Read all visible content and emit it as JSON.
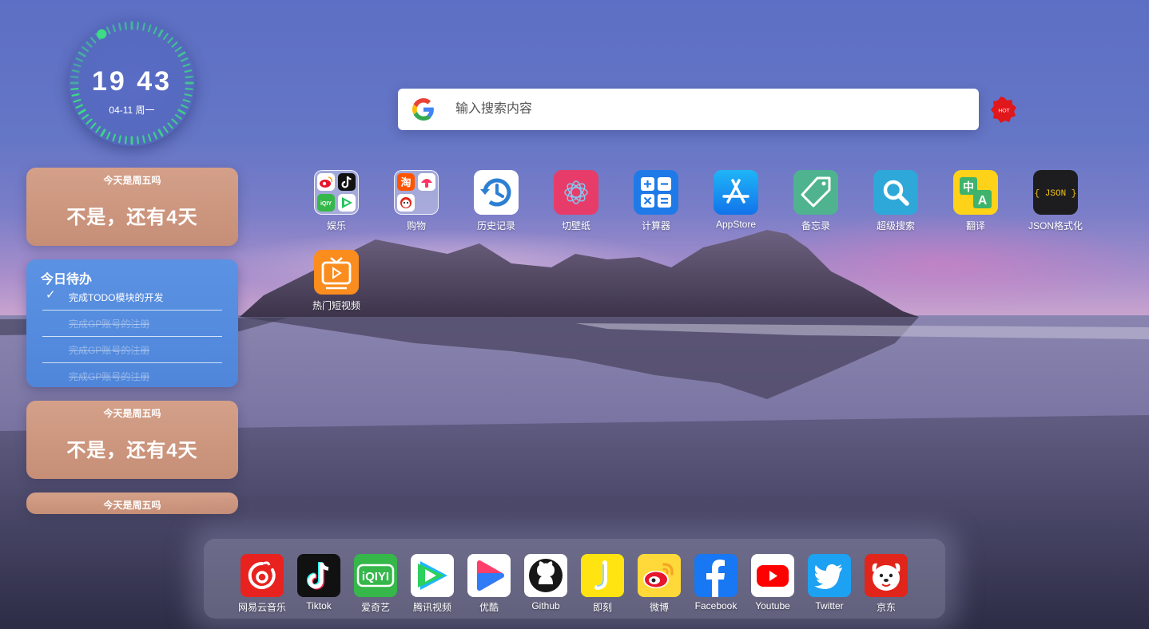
{
  "clock": {
    "time": "19 43",
    "date": "04-11 周一"
  },
  "friday_cards": [
    {
      "question": "今天是周五吗",
      "answer": "不是，还有4天"
    },
    {
      "question": "今天是周五吗",
      "answer": "不是，还有4天"
    },
    {
      "question": "今天是周五吗"
    }
  ],
  "todo": {
    "title": "今日待办",
    "items": [
      {
        "text": "完成TODO模块的开发",
        "checked": true
      },
      {
        "text": "完成GP账号的注册",
        "checked": false
      },
      {
        "text": "完成GP账号的注册",
        "checked": false
      },
      {
        "text": "完成GP账号的注册",
        "checked": false
      }
    ]
  },
  "search": {
    "placeholder": "输入搜索内容",
    "engine_icon": "google-icon",
    "hot_badge": "HOT"
  },
  "apps": [
    {
      "label": "娱乐",
      "icon": "entertainment-folder-icon"
    },
    {
      "label": "购物",
      "icon": "shopping-folder-icon"
    },
    {
      "label": "历史记录",
      "icon": "history-icon"
    },
    {
      "label": "切壁纸",
      "icon": "wallpaper-icon"
    },
    {
      "label": "计算器",
      "icon": "calculator-icon"
    },
    {
      "label": "AppStore",
      "icon": "appstore-icon"
    },
    {
      "label": "备忘录",
      "icon": "memo-tag-icon"
    },
    {
      "label": "超级搜索",
      "icon": "super-search-icon"
    },
    {
      "label": "翻译",
      "icon": "translate-icon"
    },
    {
      "label": "JSON格式化",
      "icon": "json-icon",
      "icon_text": "{ JSON }"
    },
    {
      "label": "热门短视频",
      "icon": "short-video-icon"
    }
  ],
  "dock": [
    {
      "label": "网易云音乐",
      "icon": "netease-music-icon",
      "color": "#e8231f"
    },
    {
      "label": "Tiktok",
      "icon": "tiktok-icon",
      "color": "#111111"
    },
    {
      "label": "爱奇艺",
      "icon": "iqiyi-icon",
      "color": "#35b74a",
      "icon_text": "iQIYI"
    },
    {
      "label": "腾讯视频",
      "icon": "tencent-video-icon",
      "color": "#ffffff"
    },
    {
      "label": "优酷",
      "icon": "youku-icon",
      "color": "#ffffff"
    },
    {
      "label": "Github",
      "icon": "github-icon",
      "color": "#ffffff"
    },
    {
      "label": "即刻",
      "icon": "jike-icon",
      "color": "#ffe411"
    },
    {
      "label": "微博",
      "icon": "weibo-icon",
      "color": "#ffd93a"
    },
    {
      "label": "Facebook",
      "icon": "facebook-icon",
      "color": "#1877f2"
    },
    {
      "label": "Youtube",
      "icon": "youtube-icon",
      "color": "#ffffff"
    },
    {
      "label": "Twitter",
      "icon": "twitter-icon",
      "color": "#1da1f2"
    },
    {
      "label": "京东",
      "icon": "jd-icon",
      "color": "#e1251b"
    }
  ]
}
